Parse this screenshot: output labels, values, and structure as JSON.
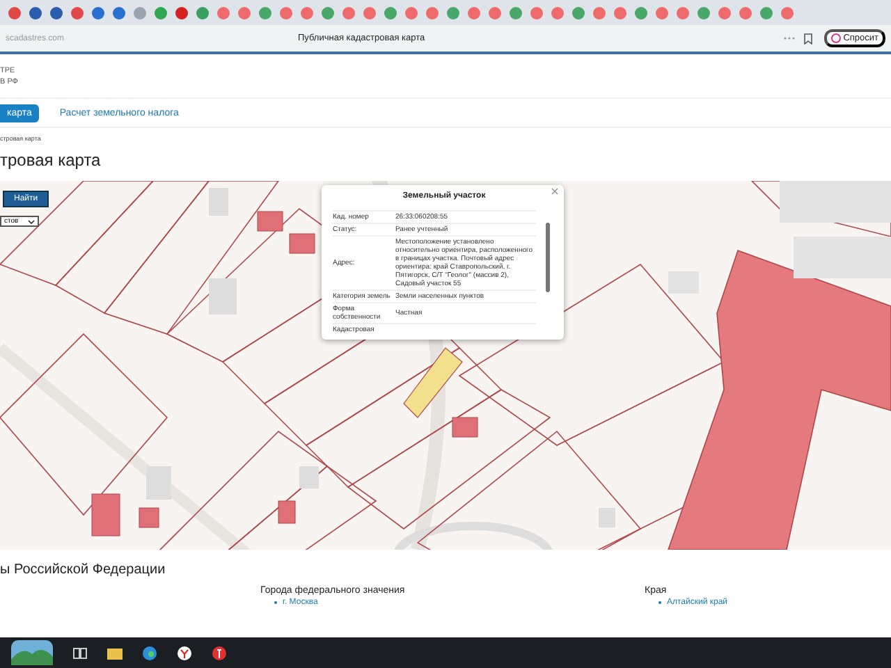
{
  "browser": {
    "url": "scadastres.com",
    "title": "Публичная кадастровая карта",
    "assistant_button": "Спросит"
  },
  "header": {
    "lines": [
      "ТРЕ",
      "В РФ"
    ]
  },
  "nav_tabs": [
    {
      "label": "карта",
      "selected": true
    },
    {
      "label": "Расчет земельного налога",
      "selected": false
    }
  ],
  "breadcrumb": "стровая карта",
  "heading": "тровая карта",
  "map": {
    "search_button": "Найти",
    "layer_select": "стов",
    "popup": {
      "title": "Земельный участок",
      "rows": [
        {
          "label": "Кад. номер",
          "value": "26:33:060208:55"
        },
        {
          "label": "Статус:",
          "value": "Ранее учтенный"
        },
        {
          "label": "Адрес:",
          "value": "Местоположение установлено относительно ориентира, расположенного в границах участка. Почтовый адрес ориентира: край Ставропольский, г. Пятигорск, С/Т \"Геолог\" (массив 2), Садовый участок 55"
        },
        {
          "label": "Категория земель",
          "value": "Земли населенных пунктов"
        },
        {
          "label": "Форма собственности",
          "value": "Частная"
        },
        {
          "label": "Кадастровая",
          "value": ""
        }
      ]
    }
  },
  "footer": {
    "title": "ы Российской Федерации",
    "columns": [
      {
        "heading": "Города федерального значения",
        "links": [
          "г. Москва"
        ]
      },
      {
        "heading": "Края",
        "links": [
          "Алтайский край"
        ]
      }
    ]
  }
}
